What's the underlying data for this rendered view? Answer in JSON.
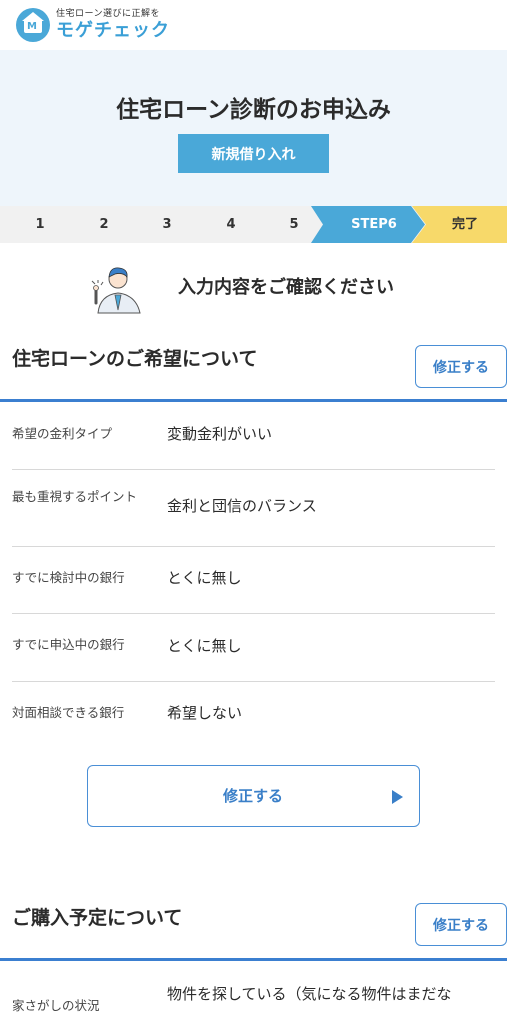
{
  "header": {
    "tagline": "住宅ローン選びに正解を",
    "brand": "モゲチェック",
    "logo_letter": "M"
  },
  "hero": {
    "title": "住宅ローン診断のお申込み",
    "tag": "新規借り入れ"
  },
  "steps": {
    "items": [
      "1",
      "2",
      "3",
      "4",
      "5"
    ],
    "current": "STEP6",
    "done": "完了",
    "colors": {
      "current": "#4aa8d8",
      "done": "#f7d96a",
      "bar": "#f1f1f1"
    }
  },
  "intro": {
    "text": "入力内容をご確認ください"
  },
  "section1": {
    "title": "住宅ローンのご希望について",
    "edit_label": "修正する",
    "rows": [
      {
        "label": "希望の金利タイプ",
        "value": "変動金利がいい"
      },
      {
        "label": "最も重視するポイント",
        "value": "金利と団信のバランス"
      },
      {
        "label": "すでに検討中の銀行",
        "value": "とくに無し"
      },
      {
        "label": "すでに申込中の銀行",
        "value": "とくに無し"
      },
      {
        "label": "対面相談できる銀行",
        "value": "希望しない"
      }
    ],
    "edit_big_label": "修正する"
  },
  "section2": {
    "title": "ご購入予定について",
    "edit_label": "修正する",
    "rows": [
      {
        "label": "家さがしの状況",
        "value": "物件を探している（気になる物件はまだな"
      }
    ]
  },
  "accent": "#3b7fd0"
}
